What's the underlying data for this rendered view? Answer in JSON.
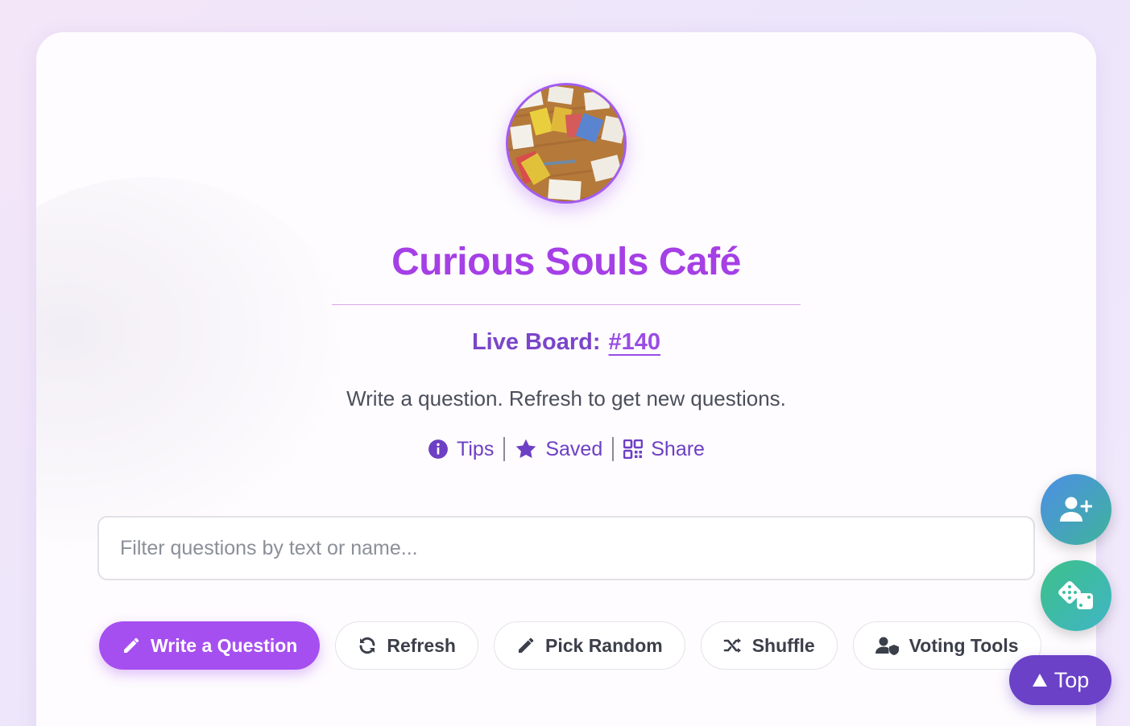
{
  "header": {
    "title": "Curious Souls Café",
    "live_board_label": "Live Board:",
    "live_board_number": "#140",
    "subtitle": "Write a question. Refresh to get new questions."
  },
  "links": [
    {
      "label": "Tips",
      "icon": "info-icon"
    },
    {
      "label": "Saved",
      "icon": "star-icon"
    },
    {
      "label": "Share",
      "icon": "qr-code-icon"
    }
  ],
  "filter": {
    "placeholder": "Filter questions by text or name...",
    "value": ""
  },
  "buttons": {
    "write": "Write a Question",
    "refresh": "Refresh",
    "pick_random": "Pick Random",
    "shuffle": "Shuffle",
    "voting_tools": "Voting Tools"
  },
  "floating": {
    "top_label": "Top",
    "add_user_icon": "user-plus-icon",
    "dice_icon": "dice-icon"
  },
  "colors": {
    "accent": "#a64ff0",
    "title": "#a53fe6",
    "link": "#6d3fc4",
    "top_button": "#6b41c8"
  }
}
